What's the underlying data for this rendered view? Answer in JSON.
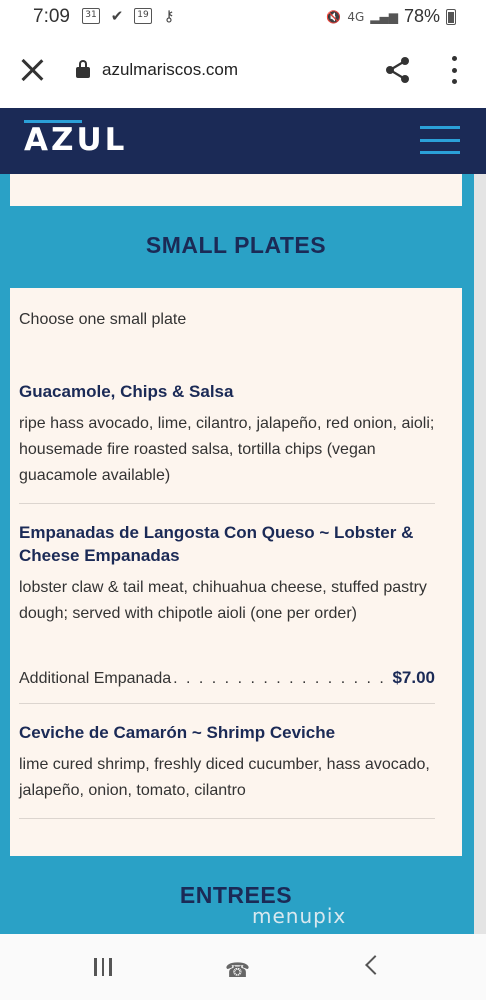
{
  "status_bar": {
    "time": "7:09",
    "left_icons": [
      "calendar-icon",
      "check-icon",
      "calendar-date-icon",
      "key-icon"
    ],
    "calendar_label": "31",
    "calendar_date_label": "19",
    "network": "4G",
    "battery": "78%"
  },
  "browser": {
    "url": "azulmariscos.com"
  },
  "site": {
    "logo": "AZUL"
  },
  "menu": {
    "section_title": "SMALL PLATES",
    "intro": "Choose one small plate",
    "items": [
      {
        "name": "Guacamole, Chips & Salsa",
        "description": "ripe hass avocado, lime, cilantro, jalapeño, red onion, aioli; housemade fire roasted salsa, tortilla chips (vegan guacamole available)"
      },
      {
        "name": "Empanadas de Langosta Con Queso ~ Lobster & Cheese Empanadas",
        "description": "lobster claw & tail meat, chihuahua cheese, stuffed pastry dough; served with chipotle aioli (one per order)",
        "addon_label": "Additional Empanada",
        "addon_price": "$7.00"
      },
      {
        "name": "Ceviche de Camarón ~ Shrimp Ceviche",
        "description": "lime cured shrimp, freshly diced cucumber, hass avocado, jalapeño, onion, tomato, cilantro"
      }
    ],
    "next_section_title": "ENTREES"
  },
  "watermark": "menupix",
  "colors": {
    "navy": "#1b2a56",
    "teal": "#2aa1c6",
    "card": "#fdf5ee",
    "accent": "#2ba0d8"
  }
}
